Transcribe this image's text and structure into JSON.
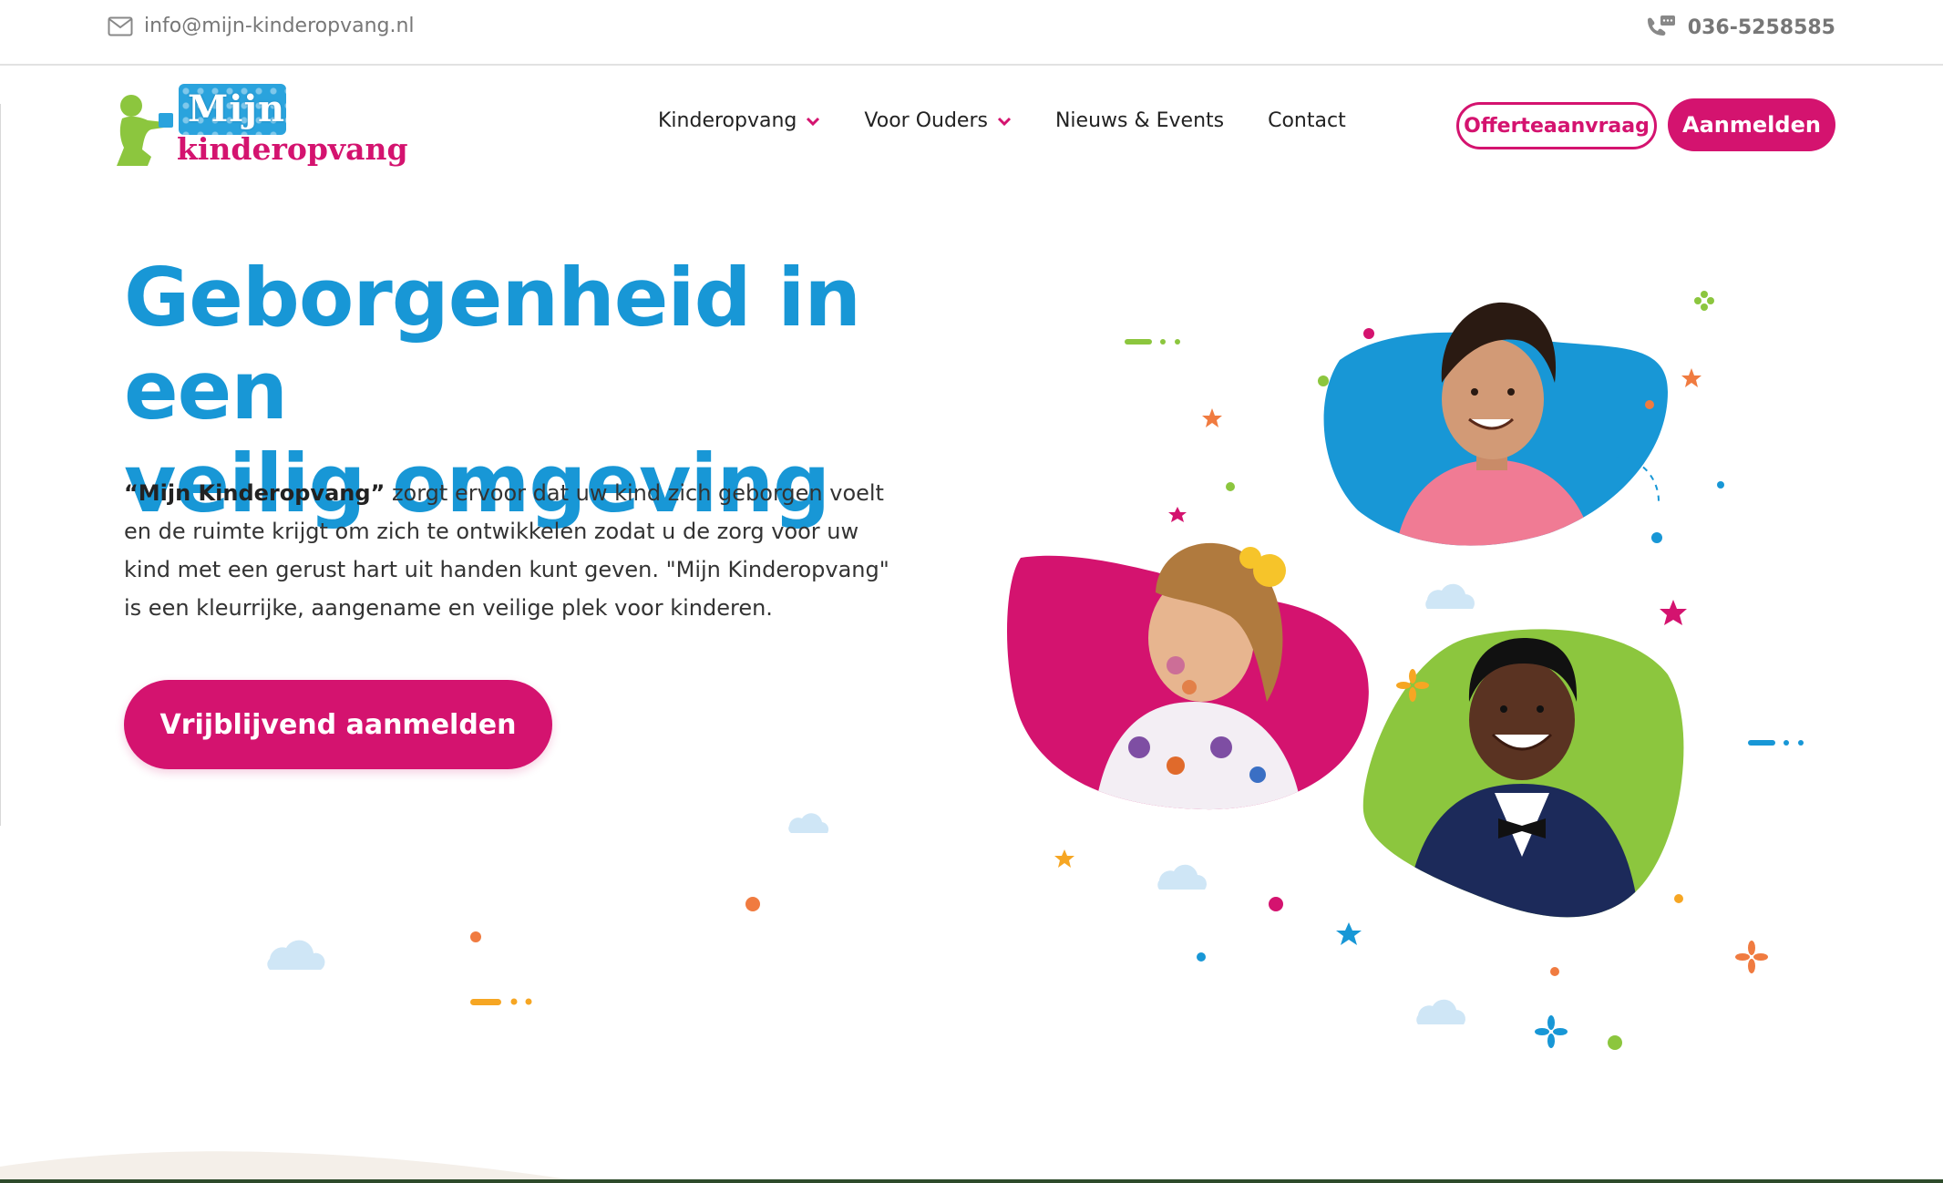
{
  "topbar": {
    "email": "info@mijn-kinderopvang.nl",
    "email_icon": "mail-icon",
    "phone": "036-5258585",
    "phone_icon": "phone-icon"
  },
  "logo": {
    "line1": "Mijn",
    "line2": "kinderopvang"
  },
  "nav": {
    "items": [
      {
        "label": "Kinderopvang",
        "has_dropdown": true
      },
      {
        "label": "Voor Ouders",
        "has_dropdown": true
      },
      {
        "label": "Nieuws & Events",
        "has_dropdown": false
      },
      {
        "label": "Contact",
        "has_dropdown": false
      }
    ],
    "quote_button": "Offerteaanvraag",
    "signup_button": "Aanmelden"
  },
  "hero": {
    "title_line1": "Geborgenheid in een",
    "title_line2": "veilig omgeving",
    "text_bold": "“Mijn Kinderopvang”",
    "text_rest": " zorgt ervoor dat uw kind zich geborgen voelt en de ruimte krijgt om zich te ontwikkelen zodat u de zorg voor uw kind met een gerust hart uit handen kunt geven. \"Mijn Kinderopvang\" is een kleurrijke, aangename en veilige plek voor kinderen.",
    "cta": "Vrijblijvend aanmelden"
  },
  "colors": {
    "brand_pink": "#d4136f",
    "brand_blue": "#1897d6",
    "brand_green": "#8cc63e",
    "text": "#333333"
  }
}
